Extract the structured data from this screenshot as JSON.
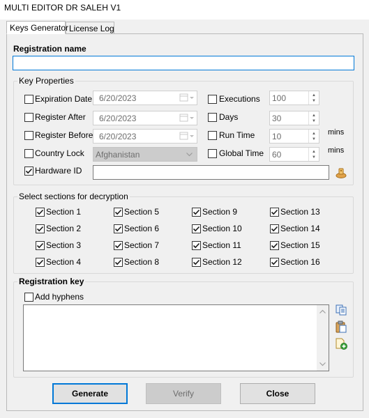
{
  "window": {
    "title": "MULTI EDITOR DR SALEH V1"
  },
  "tabs": [
    {
      "label": "Keys Generator",
      "active": true
    },
    {
      "label": "License Log",
      "active": false
    }
  ],
  "registration_name": {
    "label": "Registration name",
    "value": ""
  },
  "key_properties": {
    "label": "Key Properties",
    "expiration_date": {
      "label": "Expiration Date",
      "checked": false,
      "value": "6/20/2023"
    },
    "register_after": {
      "label": "Register After",
      "checked": false,
      "value": "6/20/2023"
    },
    "register_before": {
      "label": "Register Before",
      "checked": false,
      "value": "6/20/2023"
    },
    "country_lock": {
      "label": "Country Lock",
      "checked": false,
      "value": "Afghanistan"
    },
    "hardware_id": {
      "label": "Hardware ID",
      "checked": true,
      "value": ""
    },
    "executions": {
      "label": "Executions",
      "checked": false,
      "value": "100"
    },
    "days": {
      "label": "Days",
      "checked": false,
      "value": "30"
    },
    "run_time": {
      "label": "Run Time",
      "checked": false,
      "value": "10",
      "unit": "mins"
    },
    "global_time": {
      "label": "Global Time",
      "checked": false,
      "value": "60",
      "unit": "mins"
    }
  },
  "sections": {
    "label": "Select sections for decryption",
    "items": [
      {
        "label": "Section 1",
        "checked": true
      },
      {
        "label": "Section 2",
        "checked": true
      },
      {
        "label": "Section 3",
        "checked": true
      },
      {
        "label": "Section 4",
        "checked": true
      },
      {
        "label": "Section 5",
        "checked": true
      },
      {
        "label": "Section 6",
        "checked": true
      },
      {
        "label": "Section 7",
        "checked": true
      },
      {
        "label": "Section 8",
        "checked": true
      },
      {
        "label": "Section 9",
        "checked": true
      },
      {
        "label": "Section 10",
        "checked": true
      },
      {
        "label": "Section 11",
        "checked": true
      },
      {
        "label": "Section 12",
        "checked": true
      },
      {
        "label": "Section 13",
        "checked": true
      },
      {
        "label": "Section 14",
        "checked": true
      },
      {
        "label": "Section 15",
        "checked": true
      },
      {
        "label": "Section 16",
        "checked": true
      }
    ]
  },
  "registration_key": {
    "label": "Registration key",
    "add_hyphens": {
      "label": "Add hyphens",
      "checked": false
    },
    "value": "",
    "icons": [
      "copy-icon",
      "paste-icon",
      "add-file-icon"
    ]
  },
  "buttons": {
    "generate": "Generate",
    "verify": "Verify",
    "close": "Close"
  },
  "colors": {
    "accent": "#0078d7",
    "check": "#1a1a1a"
  }
}
